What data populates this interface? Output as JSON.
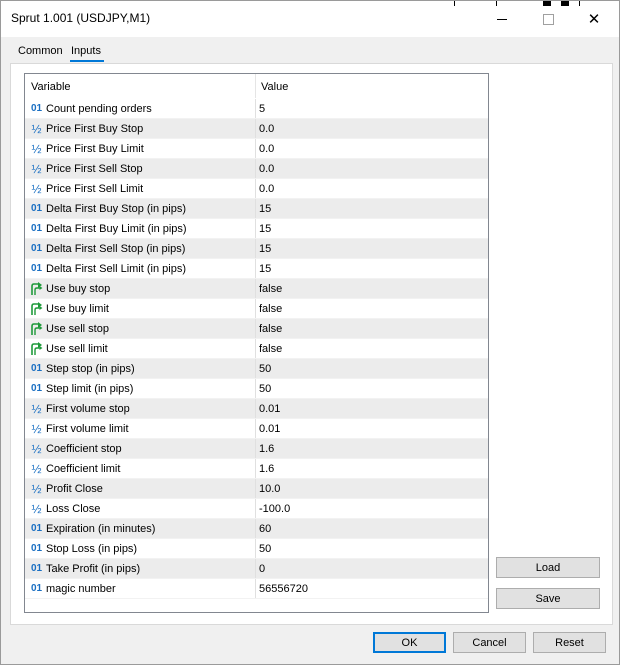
{
  "window": {
    "title": "Sprut 1.001 (USDJPY,M1)"
  },
  "tabs": [
    {
      "label": "Common",
      "active": false
    },
    {
      "label": "Inputs",
      "active": true
    }
  ],
  "table": {
    "columns": {
      "variable": "Variable",
      "value": "Value"
    },
    "rows": [
      {
        "icon": "int",
        "name": "Count pending orders",
        "value": "5"
      },
      {
        "icon": "double",
        "name": "Price First Buy Stop",
        "value": "0.0"
      },
      {
        "icon": "double",
        "name": "Price First Buy Limit",
        "value": "0.0"
      },
      {
        "icon": "double",
        "name": "Price First Sell Stop",
        "value": "0.0"
      },
      {
        "icon": "double",
        "name": "Price First Sell Limit",
        "value": "0.0"
      },
      {
        "icon": "int",
        "name": "Delta First Buy Stop (in pips)",
        "value": "15"
      },
      {
        "icon": "int",
        "name": "Delta First Buy Limit (in pips)",
        "value": "15"
      },
      {
        "icon": "int",
        "name": "Delta First Sell Stop (in pips)",
        "value": "15"
      },
      {
        "icon": "int",
        "name": "Delta First Sell Limit (in pips)",
        "value": "15"
      },
      {
        "icon": "bool",
        "name": "Use buy stop",
        "value": "false"
      },
      {
        "icon": "bool",
        "name": "Use buy limit",
        "value": "false"
      },
      {
        "icon": "bool",
        "name": "Use sell stop",
        "value": "false"
      },
      {
        "icon": "bool",
        "name": "Use sell limit",
        "value": "false"
      },
      {
        "icon": "int",
        "name": "Step stop (in pips)",
        "value": "50"
      },
      {
        "icon": "int",
        "name": "Step limit (in pips)",
        "value": "50"
      },
      {
        "icon": "double",
        "name": "First volume stop",
        "value": "0.01"
      },
      {
        "icon": "double",
        "name": "First volume limit",
        "value": "0.01"
      },
      {
        "icon": "double",
        "name": "Coefficient stop",
        "value": "1.6"
      },
      {
        "icon": "double",
        "name": "Coefficient limit",
        "value": "1.6"
      },
      {
        "icon": "double",
        "name": "Profit Close",
        "value": "10.0"
      },
      {
        "icon": "double",
        "name": "Loss Close",
        "value": "-100.0"
      },
      {
        "icon": "int",
        "name": "Expiration (in minutes)",
        "value": "60"
      },
      {
        "icon": "int",
        "name": "Stop Loss (in pips)",
        "value": "50"
      },
      {
        "icon": "int",
        "name": "Take Profit (in pips)",
        "value": "0"
      },
      {
        "icon": "int",
        "name": "magic number",
        "value": "56556720"
      }
    ]
  },
  "icons": {
    "int": "01",
    "double": "½"
  },
  "buttons": {
    "load": "Load",
    "save": "Save",
    "ok": "OK",
    "cancel": "Cancel",
    "reset": "Reset"
  },
  "colors": {
    "accent": "#0078d7",
    "type_icon": "#1a6fc2",
    "bool_icon": "#1e9a3a"
  }
}
